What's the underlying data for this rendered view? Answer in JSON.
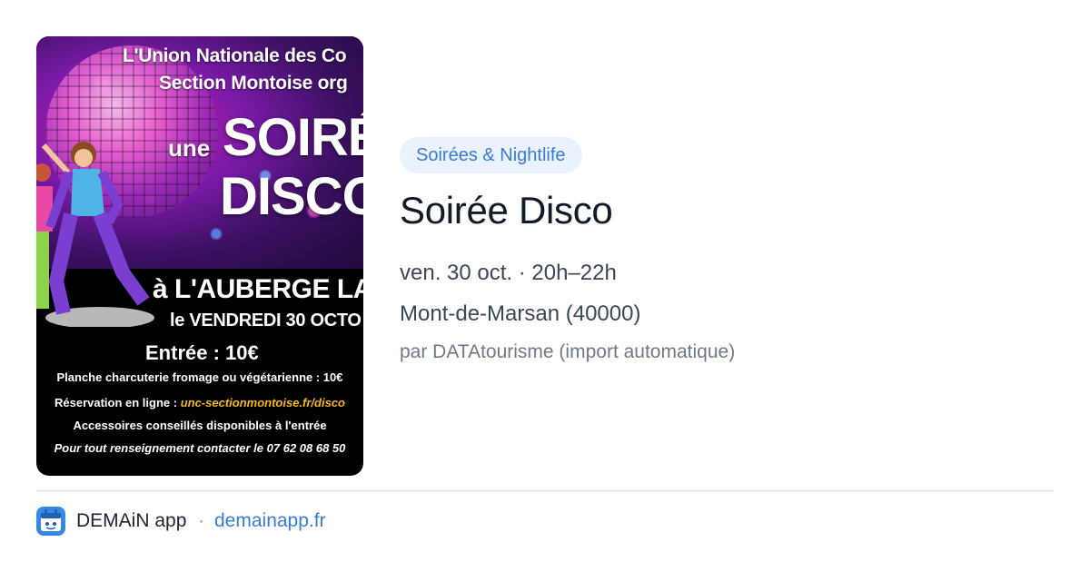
{
  "poster": {
    "line1": "L'Union Nationale des Co",
    "line2": "Section Montoise org",
    "une": "une",
    "soiree": "SOIRÉ",
    "disco": "DISCO",
    "venue": "à L'AUBERGE LA",
    "date": "le  VENDREDI 30 OCTO",
    "entree": "Entrée : 10€",
    "planche": "Planche charcuterie fromage ou végétarienne : 10€",
    "resa_label": "Réservation en ligne : ",
    "resa_link": "unc-sectionmontoise.fr/disco",
    "accessoires": "Accessoires conseillés disponibles à l'entrée",
    "contact": "Pour tout renseignement contacter le 07 62 08 68 50"
  },
  "event": {
    "category": "Soirées & Nightlife",
    "title": "Soirée Disco",
    "when": "ven. 30 oct. · 20h–22h",
    "where": "Mont-de-Marsan (40000)",
    "source": "par DATAtourisme (import automatique)"
  },
  "footer": {
    "app_name": "DEMAiN app",
    "separator": "·",
    "url": "demainapp.fr"
  },
  "colors": {
    "accent": "#3a7bd5",
    "tag_bg": "#eaf2fd",
    "app_icon": "#3a86e3"
  }
}
